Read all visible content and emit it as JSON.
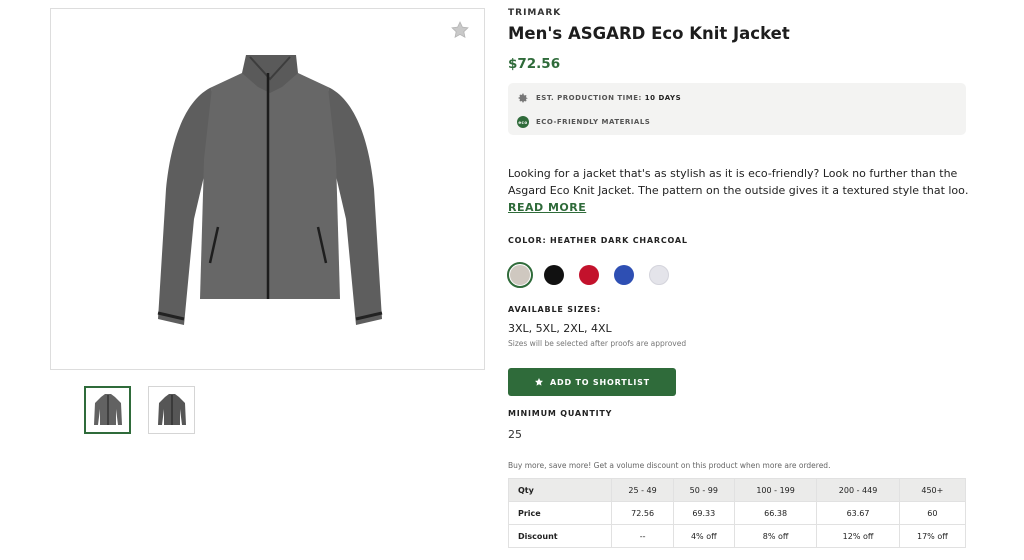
{
  "product": {
    "brand": "TRIMARK",
    "title": "Men's ASGARD Eco Knit Jacket",
    "price": "$72.56",
    "production_label": "EST. PRODUCTION TIME:",
    "production_value": "10 DAYS",
    "eco_label": "ECO-FRIENDLY MATERIALS",
    "description_line1": "Looking for a jacket that's as stylish as it is eco-friendly? Look no further than the",
    "description_line2": "Asgard Eco Knit Jacket. The pattern on the outside gives it a textured style that loo…",
    "read_more": "READ MORE"
  },
  "icons": {
    "favorite": "star-outline-icon",
    "production": "gear-icon",
    "eco": "eco-badge-icon",
    "shortlist": "star-icon"
  },
  "colors": {
    "accent": "#2f6b3a",
    "label": "COLOR:",
    "selected": "HEATHER DARK CHARCOAL",
    "swatches": [
      {
        "name": "heather-dark-charcoal",
        "hex": "#cfc8c0"
      },
      {
        "name": "black",
        "hex": "#111111"
      },
      {
        "name": "red",
        "hex": "#c3122c"
      },
      {
        "name": "blue",
        "hex": "#2e4fb3"
      },
      {
        "name": "light-grey",
        "hex": "#e4e4ea"
      }
    ]
  },
  "sizes": {
    "label": "AVAILABLE SIZES:",
    "values": "3XL, 5XL, 2XL, 4XL",
    "note": "Sizes will be selected after proofs are approved"
  },
  "actions": {
    "shortlist_label": "ADD TO SHORTLIST"
  },
  "quantity": {
    "label": "MINIMUM QUANTITY",
    "value": "25"
  },
  "pricing": {
    "note": "Buy more, save more! Get a volume discount on this product when more are ordered.",
    "header": [
      "Qty",
      "25 - 49",
      "50 - 99",
      "100 - 199",
      "200 - 449",
      "450+"
    ],
    "price_row": [
      "Price",
      "72.56",
      "69.33",
      "66.38",
      "63.67",
      "60"
    ],
    "discount_row": [
      "Discount",
      "--",
      "4% off",
      "8% off",
      "12% off",
      "17% off"
    ]
  }
}
